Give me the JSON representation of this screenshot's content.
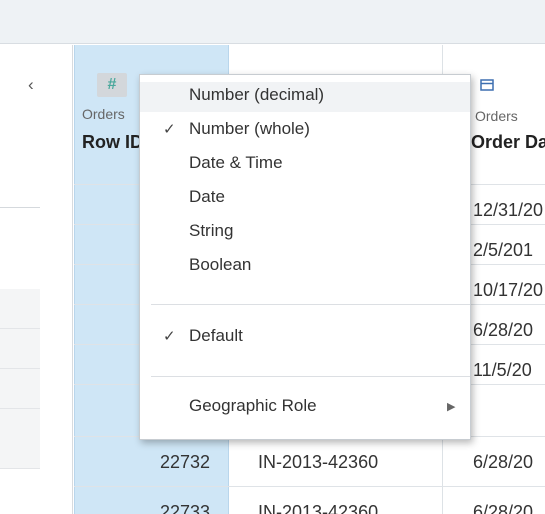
{
  "left_panel": {
    "collapse_icon": "chevron-left-icon"
  },
  "columns": {
    "row_id": {
      "type_icon": "#",
      "source": "Orders",
      "header": "Row ID"
    },
    "order_date": {
      "type_icon": "calendar-icon",
      "source": "Orders",
      "header": "Order Date"
    }
  },
  "grid": {
    "date_cells": [
      "12/31/20",
      "2/5/201",
      "10/17/20",
      "6/28/20",
      "11/5/20",
      "6/28/20"
    ],
    "visible_row": {
      "row_id": "22732",
      "order_id": "IN-2013-42360",
      "order_date": "6/28/20"
    },
    "partial_row": {
      "row_id": "22733",
      "order_id": "IN-2013-42360",
      "order_date": "6/28/20"
    }
  },
  "type_menu": {
    "items": [
      {
        "label": "Number (decimal)",
        "checked": false
      },
      {
        "label": "Number (whole)",
        "checked": true
      },
      {
        "label": "Date & Time",
        "checked": false
      },
      {
        "label": "Date",
        "checked": false
      },
      {
        "label": "String",
        "checked": false
      },
      {
        "label": "Boolean",
        "checked": false
      }
    ],
    "role_items": [
      {
        "label": "Default",
        "checked": true
      }
    ],
    "geo_item": {
      "label": "Geographic Role",
      "submenu_icon": "triangle-right-icon"
    },
    "check_glyph": "✓"
  },
  "colors": {
    "selected_column": "#cfe6f6",
    "number_type_icon": "#4aa89c",
    "date_type_icon": "#3d6fb0",
    "topbar": "#eef2f5"
  }
}
